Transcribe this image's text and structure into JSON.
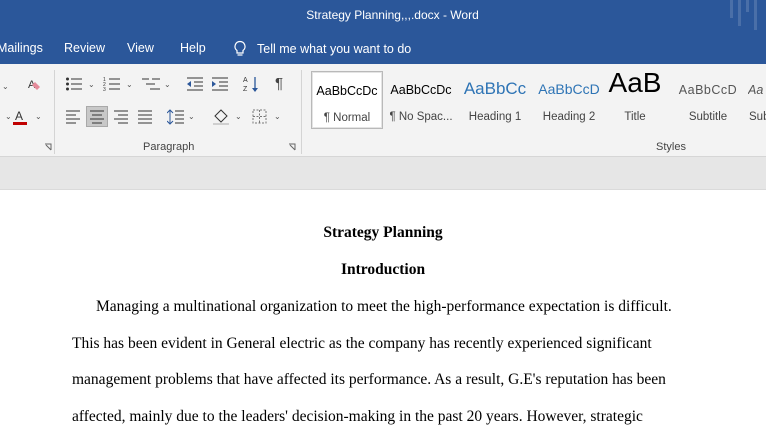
{
  "window": {
    "title": "Strategy Planning,,,.docx  -  Word"
  },
  "menu": {
    "tabs": [
      "Mailings",
      "Review",
      "View",
      "Help"
    ],
    "tellme": "Tell me what you want to do"
  },
  "ribbon": {
    "paragraph_label": "Paragraph",
    "styles_label": "Styles",
    "styles": [
      {
        "sample": "AaBbCcDc",
        "name": "¶ Normal"
      },
      {
        "sample": "AaBbCcDc",
        "name": "¶ No Spac..."
      },
      {
        "sample": "AaBbCc",
        "name": "Heading 1"
      },
      {
        "sample": "AaBbCcD",
        "name": "Heading 2"
      },
      {
        "sample": "AaB",
        "name": "Title"
      },
      {
        "sample": "AaBbCcD",
        "name": "Subtitle"
      },
      {
        "sample": "Aa",
        "name": "Sub"
      }
    ]
  },
  "document": {
    "title": "Strategy Planning",
    "heading": "Introduction",
    "lines": [
      "Managing a multinational organization to meet the high-performance expectation is difficult.",
      "This has been evident in General electric as the company has recently experienced significant",
      "management problems that have affected its performance. As a result, G.E's reputation has been",
      "affected, mainly due to the leaders' decision-making in the past 20 years. However, strategic"
    ]
  },
  "colors": {
    "titlebar": "#2b579a",
    "heading_blue": "#2e74b5",
    "font_red": "#c00000"
  }
}
